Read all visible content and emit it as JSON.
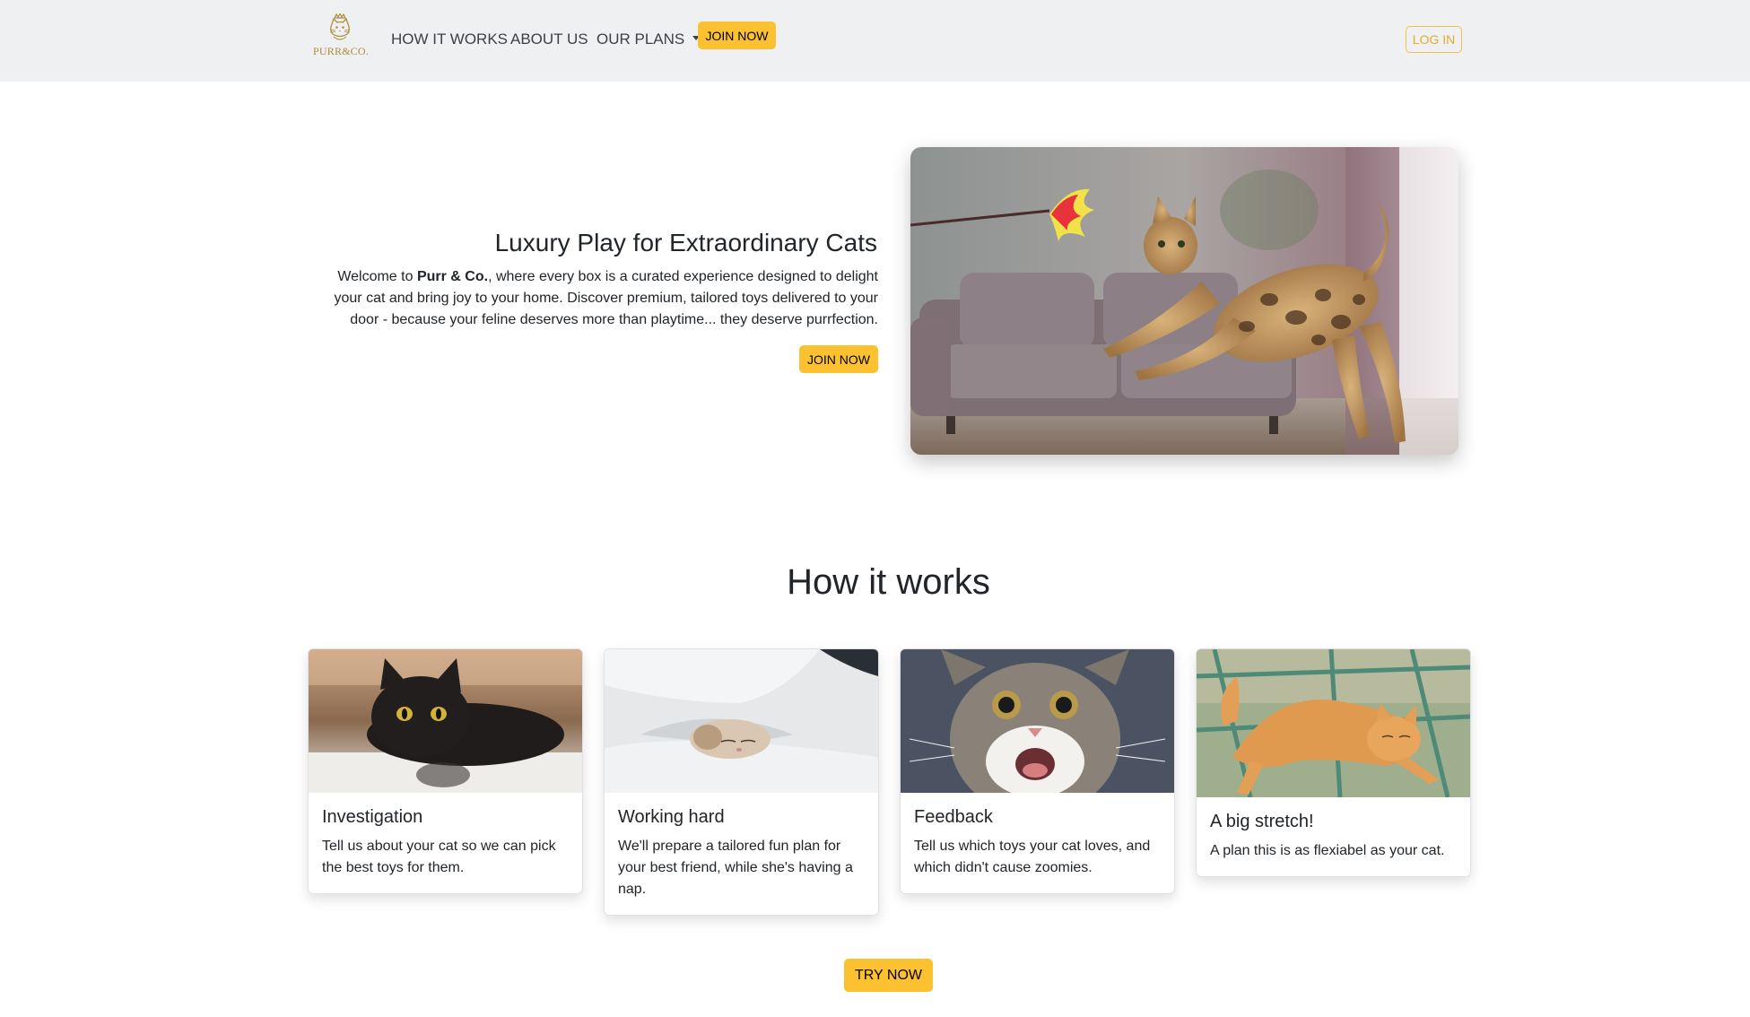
{
  "brand": {
    "logo_text": "PURR&CO."
  },
  "nav": {
    "links": [
      "HOW IT WORKS",
      "ABOUT US",
      "OUR PLANS"
    ],
    "join_label": "JOIN NOW",
    "login_label": "LOG IN"
  },
  "hero": {
    "title": "Luxury Play for Extraordinary Cats",
    "text_before": "Welcome to ",
    "brand_bold": "Purr & Co.",
    "text_after": ", where every box is a curated experience designed to delight your cat and bring joy to your home. Discover premium, tailored toys delivered to your door - because your feline deserves more than playtime... they deserve purrfection.",
    "button_label": "JOIN NOW"
  },
  "how_it_works": {
    "title": "How it works",
    "cards": [
      {
        "title": "Investigation",
        "text": "Tell us about your cat so we can pick the best toys for them."
      },
      {
        "title": "Working hard",
        "text": "We'll prepare a tailored fun plan for your best friend, while she's having a nap."
      },
      {
        "title": "Feedback",
        "text": "Tell us which toys your cat loves, and which didn't cause zoomies."
      },
      {
        "title": "A big stretch!",
        "text": "A plan this is as flexiabel as your cat."
      }
    ],
    "button_label": "TRY NOW"
  },
  "colors": {
    "accent": "#fbc131",
    "nav_bg": "#eff0f2",
    "logo_gold": "#b08d3a"
  }
}
